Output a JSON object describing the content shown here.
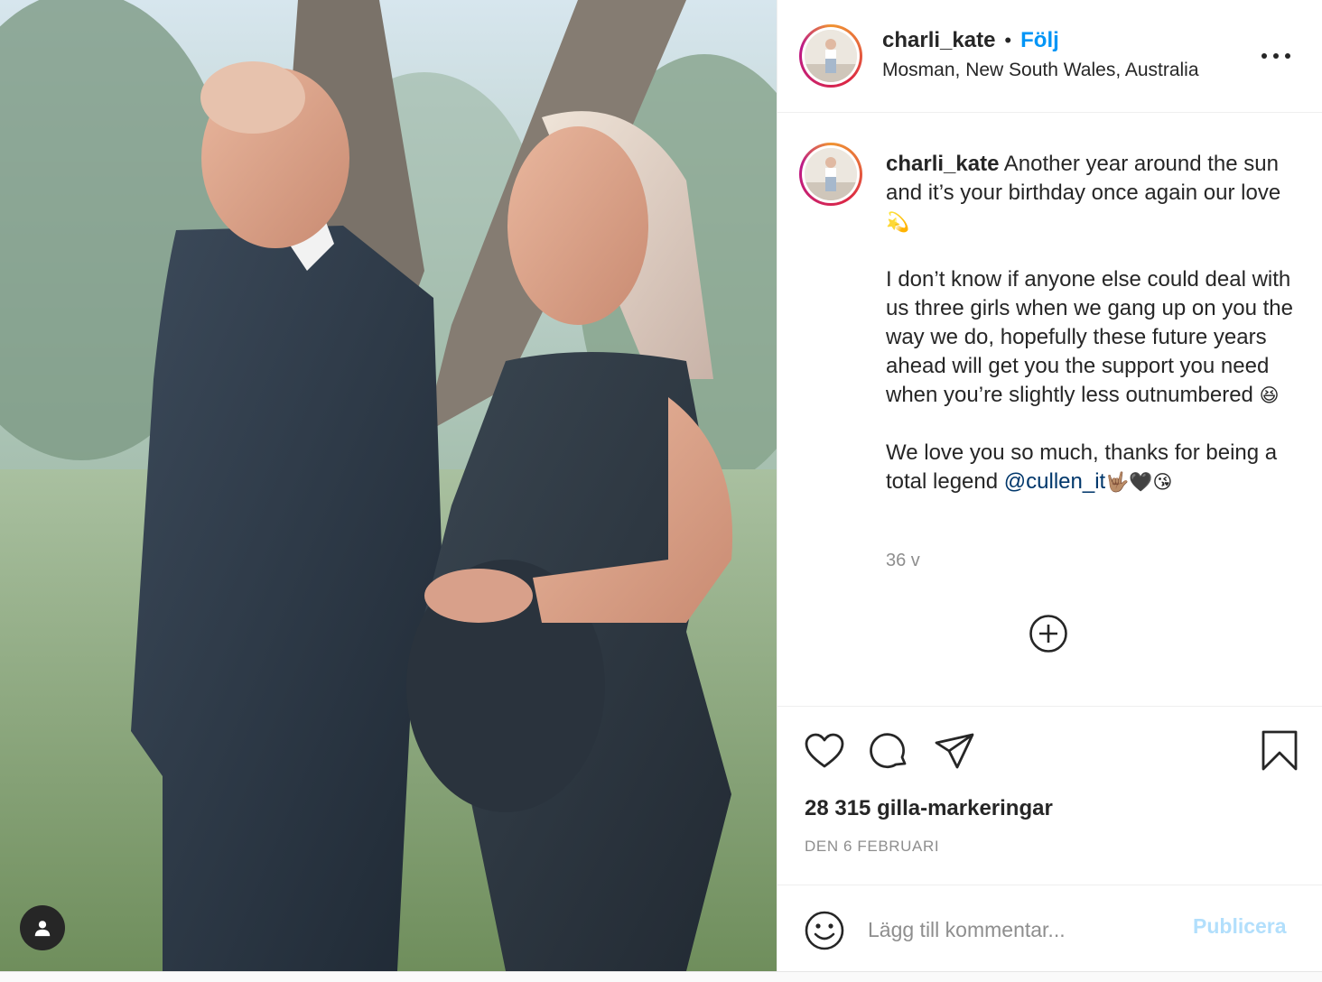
{
  "post": {
    "username": "charli_kate",
    "separator": "•",
    "follow_label": "Följ",
    "location": "Mosman, New South Wales, Australia"
  },
  "caption": {
    "username": "charli_kate",
    "line1": " Another year around the sun and it’s your birthday once again our love ",
    "emoji1": "💫",
    "para2": "I don’t know if anyone else could deal with us three girls when we gang up on you the way we do, hopefully these future years ahead will get you the support you need when you’re slightly less outnumbered ",
    "emoji2": "😆",
    "para3": "We love you so much, thanks for being a total legend ",
    "mention": "@cullen_it",
    "emoji3": "🤟🏽🖤😘",
    "time_ago": "36 v"
  },
  "stats": {
    "likes": "28 315 gilla-markeringar",
    "date": "DEN 6 FEBRUARI"
  },
  "comment": {
    "placeholder": "Lägg till kommentar...",
    "publish_label": "Publicera"
  },
  "icons": {
    "like": "heart-icon",
    "comment": "comment-bubble-icon",
    "share": "paper-plane-icon",
    "save": "bookmark-icon",
    "more": "more-options-icon",
    "load_more": "plus-circle-icon",
    "emoji": "smiley-icon",
    "tag": "user-tag-icon"
  },
  "colors": {
    "link_blue": "#0095f6",
    "mention_blue": "#00376b",
    "muted_gray": "#8e8e8e",
    "publish_disabled": "#b2dffc",
    "text": "#262626"
  }
}
